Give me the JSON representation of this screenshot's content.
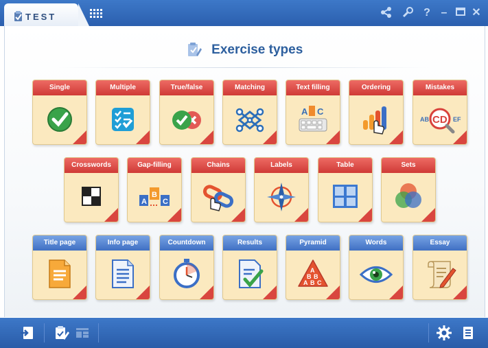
{
  "app": {
    "title": "TEST"
  },
  "titlebar": {
    "grid_icon": "grid-icon",
    "buttons": [
      {
        "name": "share-icon",
        "glyph": "✲"
      },
      {
        "name": "tools-icon",
        "glyph": "✂"
      },
      {
        "name": "help-icon",
        "glyph": "?"
      },
      {
        "name": "minimize-icon",
        "glyph": "–"
      },
      {
        "name": "maximize-icon",
        "glyph": "▭"
      },
      {
        "name": "close-icon",
        "glyph": "✕"
      }
    ]
  },
  "heading": {
    "title": "Exercise types",
    "icon": "edit-document-icon"
  },
  "cards": {
    "row1": [
      {
        "label": "Single",
        "icon": "checkmark-icon",
        "color": "red"
      },
      {
        "label": "Multiple",
        "icon": "checklist-icon",
        "color": "red"
      },
      {
        "label": "True/false",
        "icon": "true-false-icon",
        "color": "red"
      },
      {
        "label": "Matching",
        "icon": "matching-icon",
        "color": "red"
      },
      {
        "label": "Text filling",
        "icon": "keyboard-icon",
        "color": "red"
      },
      {
        "label": "Ordering",
        "icon": "ordering-icon",
        "color": "red"
      },
      {
        "label": "Mistakes",
        "icon": "magnifier-icon",
        "color": "red"
      }
    ],
    "row2": [
      {
        "label": "Crosswords",
        "icon": "crossword-icon",
        "color": "red"
      },
      {
        "label": "Gap-filling",
        "icon": "gap-filling-icon",
        "color": "red"
      },
      {
        "label": "Chains",
        "icon": "chain-icon",
        "color": "red"
      },
      {
        "label": "Labels",
        "icon": "compass-icon",
        "color": "red"
      },
      {
        "label": "Table",
        "icon": "table-icon",
        "color": "red"
      },
      {
        "label": "Sets",
        "icon": "venn-icon",
        "color": "red"
      }
    ],
    "row3": [
      {
        "label": "Title page",
        "icon": "title-page-icon",
        "color": "blue"
      },
      {
        "label": "Info page",
        "icon": "info-page-icon",
        "color": "blue"
      },
      {
        "label": "Countdown",
        "icon": "stopwatch-icon",
        "color": "blue"
      },
      {
        "label": "Results",
        "icon": "results-icon",
        "color": "blue"
      },
      {
        "label": "Pyramid",
        "icon": "pyramid-icon",
        "color": "blue"
      },
      {
        "label": "Words",
        "icon": "eye-icon",
        "color": "blue"
      },
      {
        "label": "Essay",
        "icon": "scroll-icon",
        "color": "blue"
      }
    ]
  },
  "bottombar": {
    "left": [
      "exit-icon",
      "edit-test-icon",
      "layout-icon"
    ],
    "right": [
      "settings-icon",
      "document-icon"
    ]
  },
  "colors": {
    "accent": "#2d5f9e",
    "card_bg": "#fbe9bf",
    "header_red": "#d9463f",
    "header_blue": "#4a7cc9"
  }
}
